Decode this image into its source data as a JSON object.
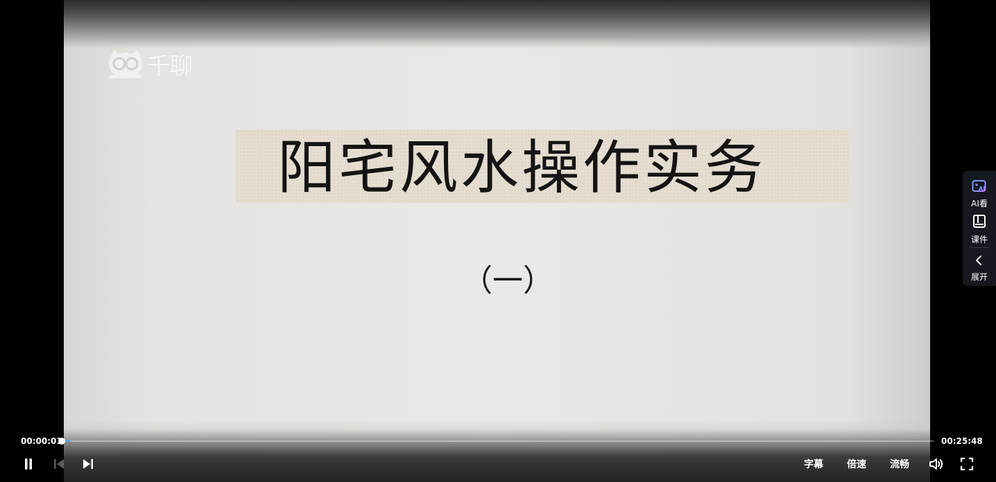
{
  "video": {
    "watermark": "千聊",
    "title": "阳宅风水操作实务",
    "subtitle": "（一）"
  },
  "side_panel": {
    "items": [
      {
        "label": "AI看",
        "icon": "ai-view-icon"
      },
      {
        "label": "课件",
        "icon": "courseware-icon"
      },
      {
        "label": "展开",
        "icon": "chevron-left-icon"
      }
    ]
  },
  "controls": {
    "current_time": "00:00:01",
    "total_time": "00:25:48",
    "progress_percent": 0.1,
    "subtitle_label": "字幕",
    "speed_label": "倍速",
    "quality_label": "流畅"
  },
  "colors": {
    "accent": "#4aa3ff",
    "panel_bg": "#16181f"
  }
}
